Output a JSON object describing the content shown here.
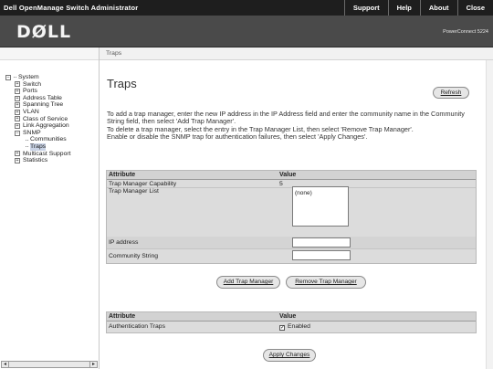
{
  "app": {
    "title": "Dell OpenManage Switch Administrator",
    "nav": [
      "Support",
      "Help",
      "About",
      "Close"
    ],
    "logo": "DØLL",
    "model": "PowerConnect 5224"
  },
  "tree": {
    "root": "System",
    "items": [
      {
        "label": "Switch",
        "expander": "+"
      },
      {
        "label": "Ports",
        "expander": "+"
      },
      {
        "label": "Address Table",
        "expander": "+"
      },
      {
        "label": "Spanning Tree",
        "expander": "+"
      },
      {
        "label": "VLAN",
        "expander": "+"
      },
      {
        "label": "Class of Service",
        "expander": "+"
      },
      {
        "label": "Link Aggregation",
        "expander": "+"
      },
      {
        "label": "SNMP",
        "expander": "−"
      },
      {
        "label": "Communities",
        "expander": ""
      },
      {
        "label": "Traps",
        "expander": ""
      },
      {
        "label": "Multicast Support",
        "expander": "+"
      },
      {
        "label": "Statistics",
        "expander": "+"
      }
    ],
    "selected": "Traps"
  },
  "breadcrumb": "Traps",
  "page": {
    "title": "Traps",
    "refresh_label": "Refresh",
    "instructions": [
      "To add a trap manager, enter the new IP address in the IP Address field and enter the community name in the Community String field, then select 'Add Trap Manager'.",
      "To delete a trap manager, select the entry in the Trap Manager List, then select 'Remove Trap Manager'.",
      "Enable or disable the SNMP trap for authentication failures, then select 'Apply Changes'."
    ]
  },
  "trap_table": {
    "col_attribute": "Attribute",
    "col_value": "Value",
    "capability_label": "Trap Manager Capability",
    "capability_value": "5",
    "list_label": "Trap Manager List",
    "list_items": [
      "(none)"
    ],
    "ip_label": "IP address",
    "ip_value": "",
    "community_label": "Community String",
    "community_value": ""
  },
  "buttons": {
    "add": "Add Trap Manager",
    "remove": "Remove Trap Manager",
    "apply": "Apply Changes"
  },
  "auth_table": {
    "col_attribute": "Attribute",
    "col_value": "Value",
    "auth_label": "Authentication Traps",
    "auth_enabled_label": "Enabled",
    "auth_checked": true
  }
}
